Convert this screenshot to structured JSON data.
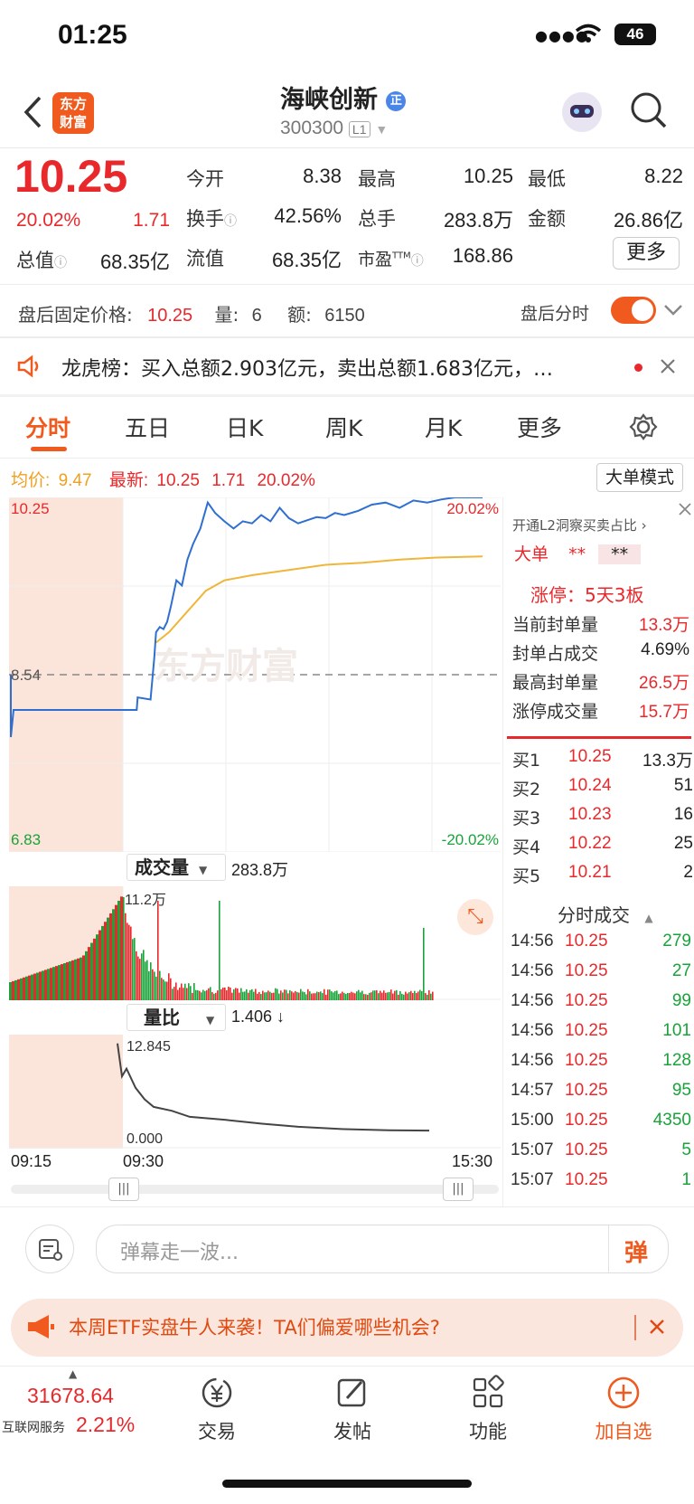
{
  "status": {
    "time": "01:25",
    "battery": "46"
  },
  "header": {
    "logo_line1": "东方",
    "logo_line2": "财富",
    "stock_name": "海峡创新",
    "badge": "正",
    "code": "300300",
    "level": "L1"
  },
  "quote": {
    "price": "10.25",
    "pct": "20.02%",
    "change": "1.71",
    "open_label": "今开",
    "open": "8.38",
    "high_label": "最高",
    "high": "10.25",
    "low_label": "最低",
    "low": "8.22",
    "turnover_label": "换手",
    "turnover": "42.56%",
    "volume_label": "总手",
    "volume": "283.8万",
    "amount_label": "金额",
    "amount": "26.86亿",
    "mktcap_label": "总值",
    "mktcap": "68.35亿",
    "float_label": "流值",
    "float": "68.35亿",
    "pe_label": "市盈",
    "pe_sup": "TTM",
    "pe": "168.86",
    "more": "更多"
  },
  "afterhours": {
    "label": "盘后固定价格:",
    "price": "10.25",
    "qty_label": "量:",
    "qty": "6",
    "amt_label": "额:",
    "amt": "6150",
    "toggle_label": "盘后分时",
    "toggle_on": true
  },
  "news": {
    "text": "龙虎榜：买入总额2.903亿元，卖出总额1.683亿元，…"
  },
  "tabs": [
    "分时",
    "五日",
    "日K",
    "周K",
    "月K",
    "更多"
  ],
  "chart_info": {
    "avg_label": "均价:",
    "avg": "9.47",
    "latest_label": "最新:",
    "latest": "10.25",
    "chg": "1.71",
    "pct": "20.02%",
    "mode_button": "大单模式"
  },
  "chart_data": [
    {
      "type": "line",
      "y_top_label": "10.25",
      "y_mid_label": "8.54",
      "y_bottom_label": "6.83",
      "pct_top": "20.02%",
      "pct_bottom": "-20.02%",
      "ylim": [
        6.83,
        10.25
      ],
      "x_ticks": [
        "09:15",
        "09:30",
        "15:30"
      ],
      "series": [
        {
          "name": "最新",
          "color": "#2f6fcf",
          "x": [
            0,
            15,
            16,
            30,
            34,
            36,
            40,
            44,
            48,
            52,
            58,
            64,
            70,
            76,
            84,
            92,
            100,
            110,
            120,
            130,
            140,
            150,
            160,
            170,
            180,
            190,
            200,
            210,
            220,
            230,
            240,
            255,
            270,
            285,
            300,
            315,
            330,
            345,
            360,
            375,
            390
          ],
          "y": [
            8.2,
            8.2,
            8.32,
            8.3,
            8.7,
            8.95,
            9.0,
            8.98,
            9.05,
            9.2,
            9.45,
            9.4,
            9.65,
            9.8,
            9.95,
            10.2,
            10.1,
            10.02,
            9.95,
            10.02,
            10.0,
            10.08,
            10.02,
            10.15,
            10.05,
            10.0,
            10.03,
            10.06,
            10.05,
            10.1,
            10.08,
            10.12,
            10.18,
            10.2,
            10.15,
            10.22,
            10.2,
            10.23,
            10.25,
            10.25,
            10.25
          ]
        },
        {
          "name": "均价",
          "color": "#f0b63a",
          "x": [
            36,
            50,
            70,
            90,
            110,
            140,
            180,
            220,
            260,
            300,
            340,
            390
          ],
          "y": [
            8.85,
            8.95,
            9.15,
            9.35,
            9.45,
            9.5,
            9.55,
            9.6,
            9.62,
            9.65,
            9.67,
            9.68
          ]
        }
      ]
    },
    {
      "type": "bar",
      "title": "成交量",
      "total": "283.8万",
      "max_label": "11.2万"
    },
    {
      "type": "line",
      "title": "量比",
      "current": "1.406 ↓",
      "max_label": "12.845",
      "min_label": "0.000",
      "x": [
        0,
        5,
        10,
        20,
        30,
        40,
        60,
        80,
        120,
        160,
        200,
        250,
        300,
        345
      ],
      "y": [
        12.8,
        8.5,
        9.5,
        7.0,
        5.5,
        4.5,
        4.0,
        3.2,
        2.8,
        2.3,
        1.9,
        1.6,
        1.45,
        1.406
      ]
    }
  ],
  "right_panel": {
    "title": "开通L2洞察买卖占比 ›",
    "big_order": "大单",
    "stars1": "**",
    "stars2": "**",
    "limit_up": "涨停：5天3板",
    "stats": [
      {
        "k": "当前封单量",
        "v": "13.3万"
      },
      {
        "k": "封单占成交",
        "v": "4.69%"
      },
      {
        "k": "最高封单量",
        "v": "26.5万"
      },
      {
        "k": "涨停成交量",
        "v": "15.7万"
      }
    ],
    "bids": [
      {
        "k": "买1",
        "p": "10.25",
        "q": "13.3万"
      },
      {
        "k": "买2",
        "p": "10.24",
        "q": "51"
      },
      {
        "k": "买3",
        "p": "10.23",
        "q": "16"
      },
      {
        "k": "买4",
        "p": "10.22",
        "q": "25"
      },
      {
        "k": "买5",
        "p": "10.21",
        "q": "2"
      }
    ],
    "ticks_title": "分时成交",
    "ticks": [
      {
        "t": "14:56",
        "p": "10.25",
        "q": "279"
      },
      {
        "t": "14:56",
        "p": "10.25",
        "q": "27"
      },
      {
        "t": "14:56",
        "p": "10.25",
        "q": "99"
      },
      {
        "t": "14:56",
        "p": "10.25",
        "q": "101"
      },
      {
        "t": "14:56",
        "p": "10.25",
        "q": "128"
      },
      {
        "t": "14:57",
        "p": "10.25",
        "q": "95"
      },
      {
        "t": "15:00",
        "p": "10.25",
        "q": "4350"
      },
      {
        "t": "15:07",
        "p": "10.25",
        "q": "5"
      },
      {
        "t": "15:07",
        "p": "10.25",
        "q": "1"
      }
    ]
  },
  "danmaku": {
    "placeholder": "弹幕走一波...",
    "send": "弹"
  },
  "ad": {
    "text": "本周ETF实盘牛人来袭！TA们偏爱哪些机会?"
  },
  "bottom_nav": {
    "index_value": "31678.64",
    "index_name": "互联网服务",
    "index_pct": "2.21%",
    "items": [
      "交易",
      "发帖",
      "功能",
      "加自选"
    ]
  },
  "watermark": "东方财富"
}
